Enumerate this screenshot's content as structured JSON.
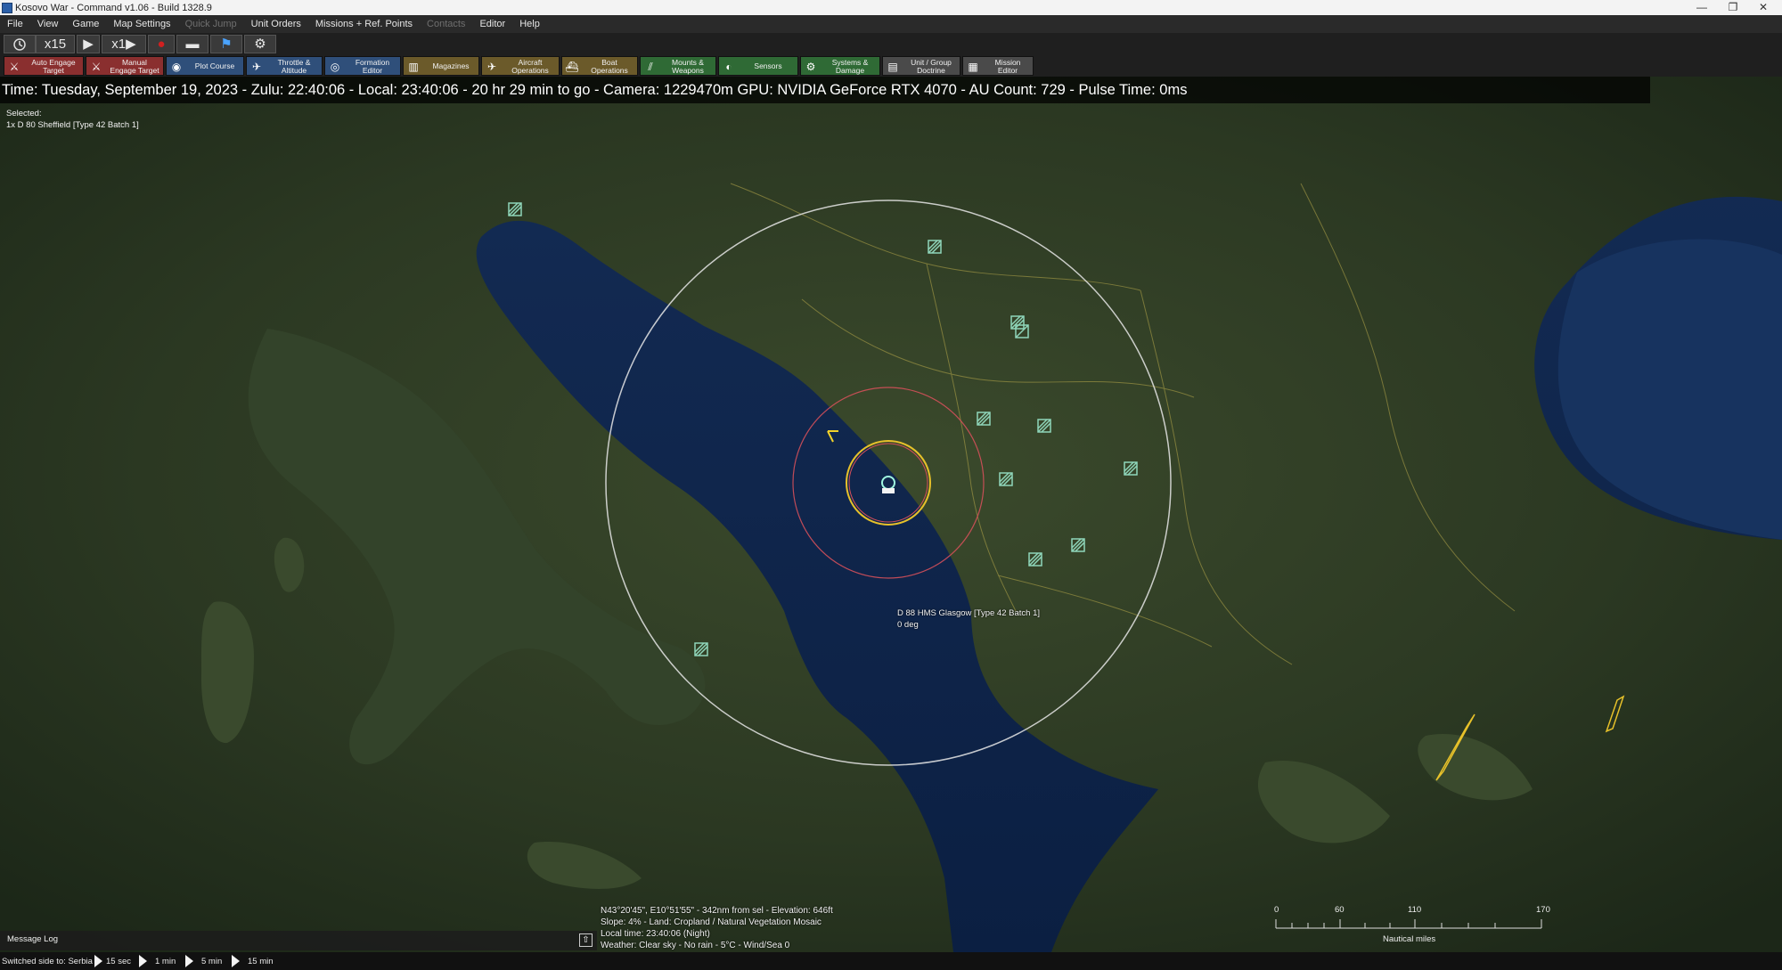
{
  "window": {
    "title": "Kosovo War - Command v1.06 - Build 1328.9",
    "controls": [
      "—",
      "❐",
      "✕"
    ]
  },
  "menu": [
    {
      "label": "File",
      "enabled": true
    },
    {
      "label": "View",
      "enabled": true
    },
    {
      "label": "Game",
      "enabled": true
    },
    {
      "label": "Map Settings",
      "enabled": true
    },
    {
      "label": "Quick Jump",
      "enabled": false
    },
    {
      "label": "Unit Orders",
      "enabled": true
    },
    {
      "label": "Missions + Ref. Points",
      "enabled": true
    },
    {
      "label": "Contacts",
      "enabled": false
    },
    {
      "label": "Editor",
      "enabled": true
    },
    {
      "label": "Help",
      "enabled": true
    }
  ],
  "toolbar1": {
    "speed_multiplier": "x15",
    "compression": "x1"
  },
  "toolbar2": [
    {
      "label": "Auto Engage\nTarget",
      "color": "#8a2f2f",
      "icon": "⚔"
    },
    {
      "label": "Manual\nEngage Target",
      "color": "#8a2f2f",
      "icon": "⚔"
    },
    {
      "label": "Plot Course",
      "color": "#2f4f7a",
      "icon": "◉"
    },
    {
      "label": "Throttle &\nAltitude",
      "color": "#2f4f7a",
      "icon": "✈"
    },
    {
      "label": "Formation\nEditor",
      "color": "#2f4f7a",
      "icon": "◎"
    },
    {
      "label": "Magazines",
      "color": "#6b5a2a",
      "icon": "▥"
    },
    {
      "label": "Aircraft\nOperations",
      "color": "#6b5a2a",
      "icon": "✈"
    },
    {
      "label": "Boat\nOperations",
      "color": "#6b5a2a",
      "icon": "⛴"
    },
    {
      "label": "Mounts &\nWeapons",
      "color": "#2f6a35",
      "icon": "⫽"
    },
    {
      "label": "Sensors",
      "color": "#2f6a35",
      "icon": "◐"
    },
    {
      "label": "Systems &\nDamage",
      "color": "#2f6a35",
      "icon": "⚙"
    },
    {
      "label": "Unit / Group\nDoctrine",
      "color": "#4a4a4a",
      "icon": "▤"
    },
    {
      "label": "Mission\nEditor",
      "color": "#4a4a4a",
      "icon": "▦"
    }
  ],
  "infobar": "Time: Tuesday, September 19, 2023 - Zulu: 22:40:06 - Local: 23:40:06 - 20 hr 29 min to go -  Camera: 1229470m  GPU: NVIDIA GeForce RTX 4070 - AU Count: 729 - Pulse Time: 0ms",
  "selected": {
    "title": "Selected:",
    "unit": "1x D 80 Sheffield [Type 42 Batch 1]"
  },
  "unit_label": {
    "name": "D 88 HMS Glasgow [Type 42 Batch 1]",
    "heading": "0 deg"
  },
  "cursor_info": [
    "N43°20'45\", E10°51'55\" - 342nm from sel - Elevation: 646ft",
    "Slope: 4%  - Land: Cropland / Natural Vegetation Mosaic",
    "Local time: 23:40:06 (Night)",
    "Weather: Clear sky - No rain - 5°C - Wind/Sea 0"
  ],
  "scale": {
    "ticks": [
      "0",
      "60",
      "110",
      "170"
    ],
    "unit": "Nautical miles"
  },
  "message_log": "Message Log",
  "status": {
    "text": "Switched side to: Serbia",
    "steps": [
      "15 sec",
      "1 min",
      "5 min",
      "15 min"
    ]
  }
}
